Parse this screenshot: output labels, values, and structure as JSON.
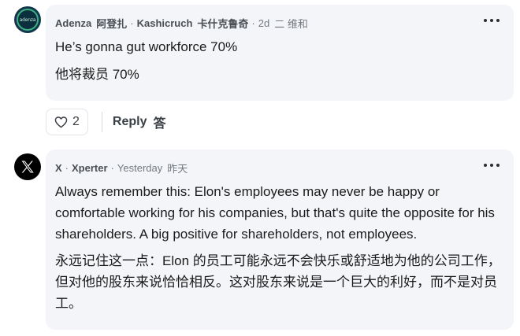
{
  "comments": [
    {
      "author": "Adenza",
      "author_zh": "阿登扎",
      "handle": "Kashicruch",
      "handle_zh": "卡什克鲁奇",
      "time": "2d",
      "time_zh": "二 维和",
      "avatar_text": "adenza",
      "lines": [
        "He’s gonna gut workforce 70%",
        "他将裁员 70%"
      ],
      "likes": "2",
      "reply_label": "Reply",
      "reply_label_zh": "答",
      "more_icon": "more-horizontal-icon",
      "like_icon": "heart-icon"
    },
    {
      "author": "X",
      "handle": "Xperter",
      "time": "Yesterday",
      "time_zh": "昨天",
      "avatar_text": "X",
      "lines": [
        "Always remember this: Elon's employees may never be happy or comfortable working for his companies, but that's quite the opposite for his shareholders.  A big positive for shareholders, not employees.",
        "永远记住这一点：Elon 的员工可能永远不会快乐或舒适地为他的公司工作，但对他的股东来说恰恰相反。这对股东来说是一个巨大的利好，而不是对员工。"
      ],
      "more_icon": "more-horizontal-icon"
    }
  ]
}
